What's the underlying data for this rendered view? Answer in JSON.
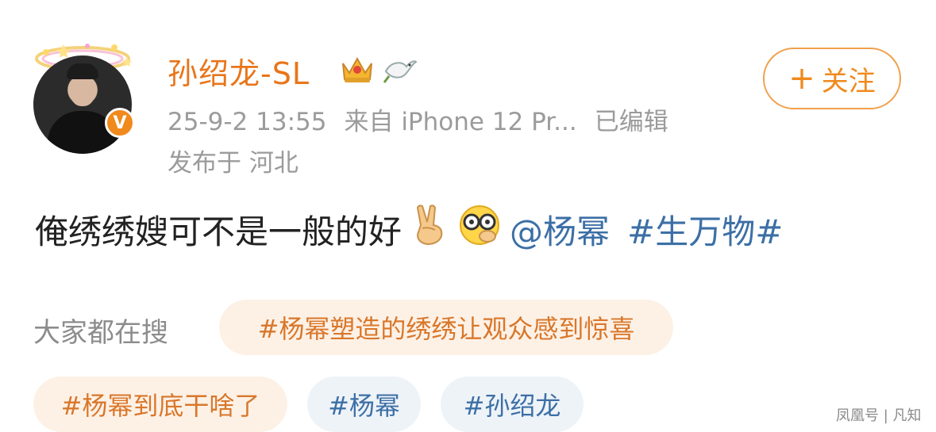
{
  "user": {
    "name": "孙绍龙-SL",
    "verified_badge": "V",
    "icons": [
      "crown-icon",
      "dove-icon",
      "halo-icon"
    ]
  },
  "meta": {
    "time": "25-9-2 13:55",
    "source": "来自 iPhone 12 Pr...",
    "edited": "已编辑",
    "location": "发布于 河北"
  },
  "follow": {
    "plus": "+",
    "label": "关注"
  },
  "post": {
    "text": "俺绣绣嫂可不是一般的好",
    "mention": "@杨幂",
    "topic": "#生万物#",
    "emojis": [
      "victory-hand-emoji",
      "glasses-face-emoji"
    ]
  },
  "search": {
    "label": "大家都在搜",
    "chips": [
      {
        "text": "#杨幂塑造的绣绣让观众感到惊喜",
        "style": "orange"
      },
      {
        "text": "#杨幂到底干啥了",
        "style": "orange"
      },
      {
        "text": "#杨幂",
        "style": "blue"
      },
      {
        "text": "#孙绍龙",
        "style": "blue"
      }
    ]
  },
  "watermark": "凤凰号 | 凡知",
  "colors": {
    "accent_orange": "#e8761a",
    "link_blue": "#3c6fa6",
    "meta_gray": "#9b9b9b"
  }
}
